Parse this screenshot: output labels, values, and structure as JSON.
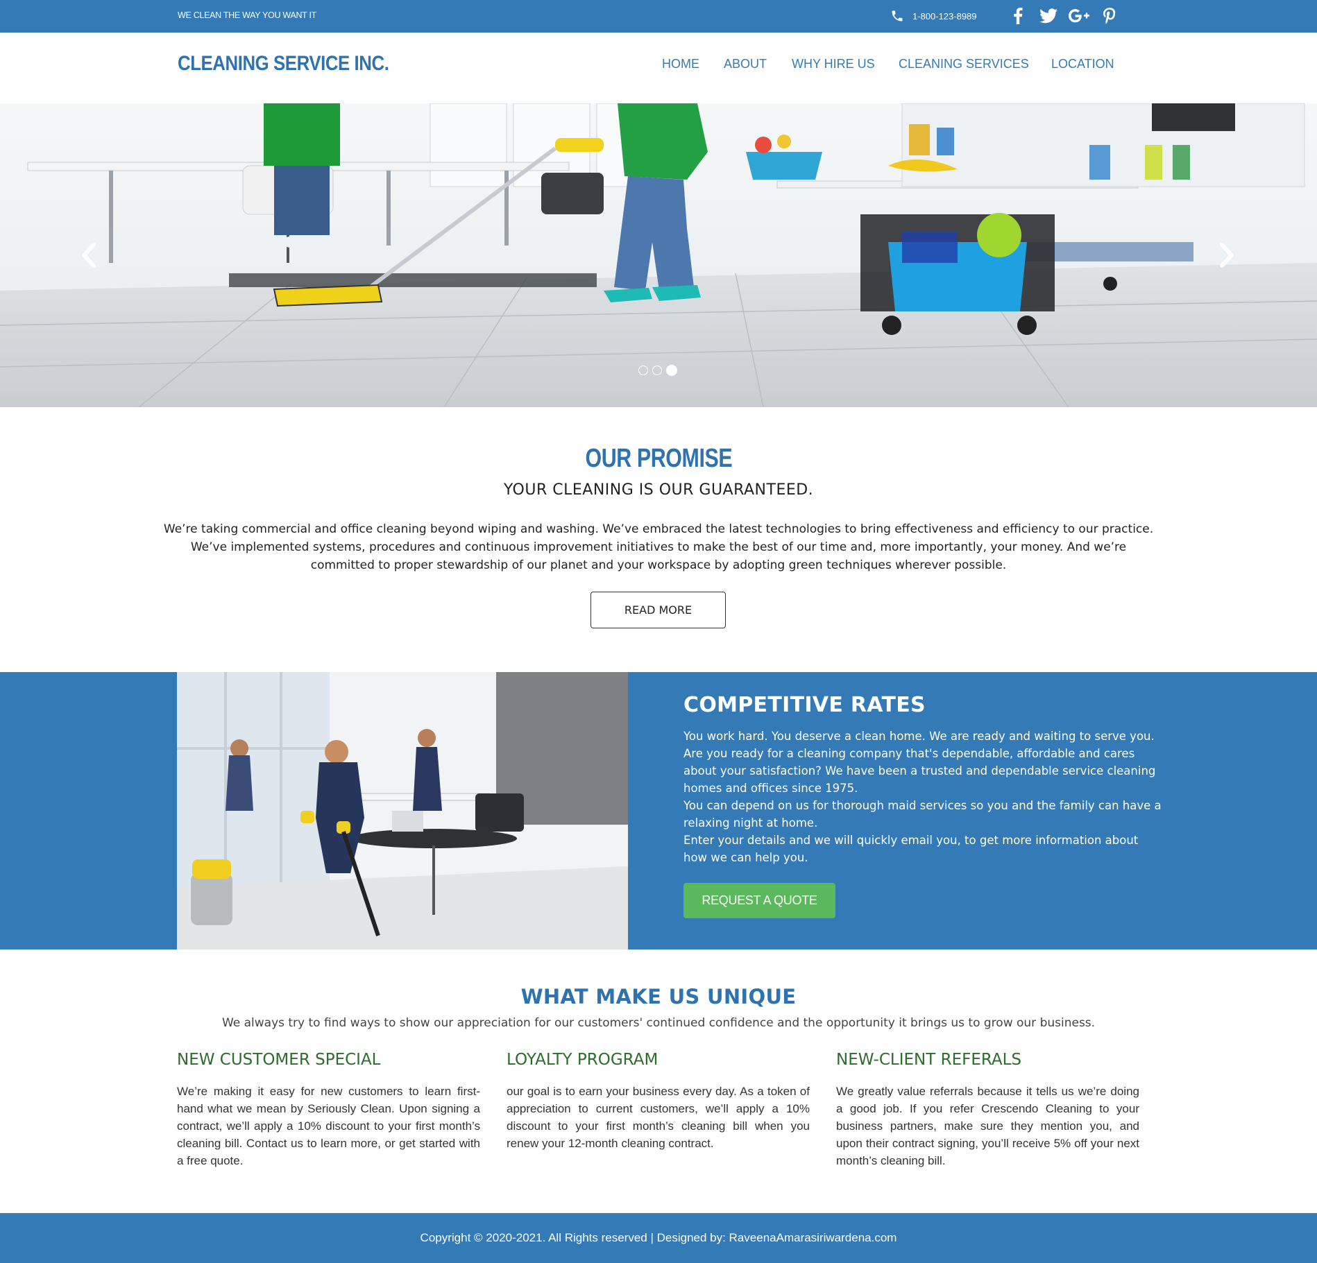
{
  "topbar": {
    "tagline": "WE CLEAN THE WAY YOU WANT IT",
    "phone": "1-800-123-8989",
    "phone_icon": "phone-icon",
    "socials": [
      "facebook-icon",
      "twitter-icon",
      "google-plus-icon",
      "pinterest-icon"
    ]
  },
  "header": {
    "brand": "CLEANING SERVICE INC.",
    "nav": [
      "HOME",
      "ABOUT",
      "WHY HIRE US",
      "CLEANING SERVICES",
      "LOCATION"
    ]
  },
  "hero": {
    "prev_icon": "chevron-left-icon",
    "next_icon": "chevron-right-icon",
    "slide_count": 3,
    "active_slide": 3
  },
  "promise": {
    "title": "OUR PROMISE",
    "subtitle": "YOUR CLEANING IS OUR GUARANTEED.",
    "body": "We’re taking commercial and office cleaning beyond wiping and washing. We’ve embraced the latest technologies to bring effectiveness and efficiency to our practice. We’ve implemented systems, procedures and continuous improvement initiatives to make the best of our time and, more importantly, your money. And we’re committed to proper stewardship of our planet and your workspace by adopting green techniques wherever possible.",
    "button": "READ MORE"
  },
  "rates": {
    "title": "COMPETITIVE RATES",
    "para1": "You work hard. You deserve a clean home. We are ready and waiting to serve you. Are you ready for a cleaning company that's dependable, affordable and cares about your satisfaction? We have been a trusted and dependable service cleaning homes and offices since 1975.",
    "para2": "You can depend on us for thorough maid services so you and the family can have a relaxing night at home.",
    "para3": "Enter your details and we will quickly email you, to get more information about how we can help you.",
    "button": "REQUEST A QUOTE"
  },
  "unique": {
    "title": "WHAT MAKE US UNIQUE",
    "subtitle": "We always try to find ways to show our appreciation for our customers' continued confidence and the opportunity it brings us to grow our business.",
    "columns": [
      {
        "heading": "NEW CUSTOMER SPECIAL",
        "text": "We’re making it easy for new customers to learn first-hand what we mean by Seriously Clean. Upon signing a contract, we’ll apply a 10% discount to your first month’s cleaning bill. Contact us to learn more, or get started with a free quote."
      },
      {
        "heading": "LOYALTY PROGRAM",
        "text": "our goal is to earn your business every day. As a token of appreciation to current customers, we’ll apply a 10% discount to your first month’s cleaning bill when you renew your 12-month cleaning contract."
      },
      {
        "heading": "NEW-CLIENT REFERALS",
        "text": "We greatly value referrals because it tells us we’re doing a good job. If you refer Crescendo Cleaning to your business partners, make sure they mention you, and upon their contract signing, you’ll receive 5% off your next month’s cleaning bill."
      }
    ]
  },
  "footer": {
    "text": "Copyright © 2020-2021. All Rights reserved | Designed by: RaveenaAmarasiriwardena.com"
  },
  "colors": {
    "brand_blue": "#337ab7",
    "quote_green": "#5cb85c",
    "heading_green": "#2e6b2e"
  }
}
